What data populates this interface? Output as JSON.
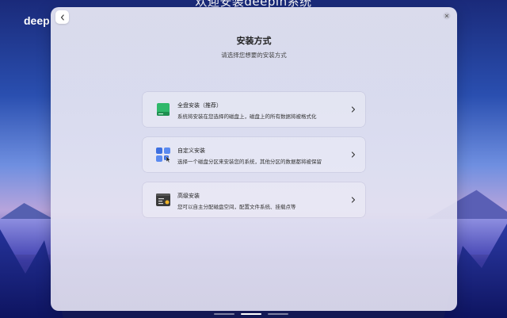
{
  "window": {
    "top_title": "欢迎安装deepin系统",
    "brand": "deep"
  },
  "dialog": {
    "title": "安装方式",
    "subtitle": "请选择您想要的安装方式",
    "options": [
      {
        "title": "全盘安装（推荐）",
        "description": "系统将安装在您选择的磁盘上，磁盘上的所有数据将被格式化",
        "icon": "disk-icon"
      },
      {
        "title": "自定义安装",
        "description": "选择一个磁盘分区来安装您的系统，其他分区的数据都将被保留",
        "icon": "custom-grid-icon"
      },
      {
        "title": "高级安装",
        "description": "您可以自主分配磁盘空间，配置文件系统、挂载点等",
        "icon": "terminal-icon"
      }
    ]
  },
  "colors": {
    "disk_green": "#2fb86a",
    "custom_blue": "#3d6fe0",
    "terminal_dark": "#3a3a3a"
  }
}
